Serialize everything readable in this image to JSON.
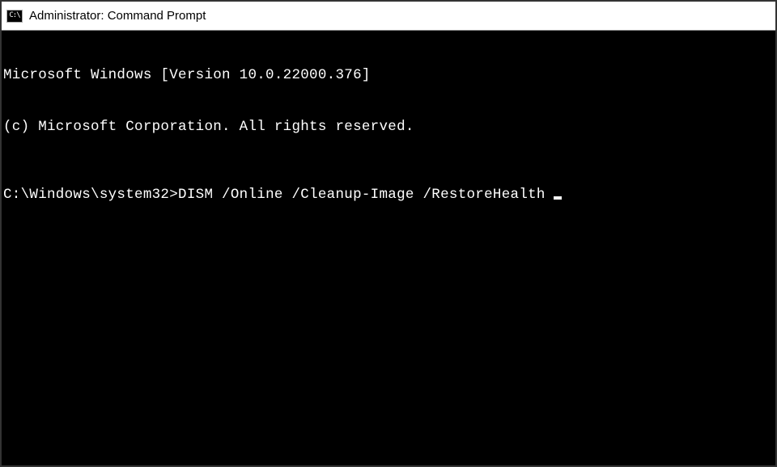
{
  "titlebar": {
    "icon_label": "cmd-icon",
    "icon_text": "C:\\",
    "title": "Administrator: Command Prompt"
  },
  "terminal": {
    "line1": "Microsoft Windows [Version 10.0.22000.376]",
    "line2": "(c) Microsoft Corporation. All rights reserved.",
    "prompt_path": "C:\\Windows\\system32>",
    "command": "DISM /Online /Cleanup-Image /RestoreHealth"
  }
}
